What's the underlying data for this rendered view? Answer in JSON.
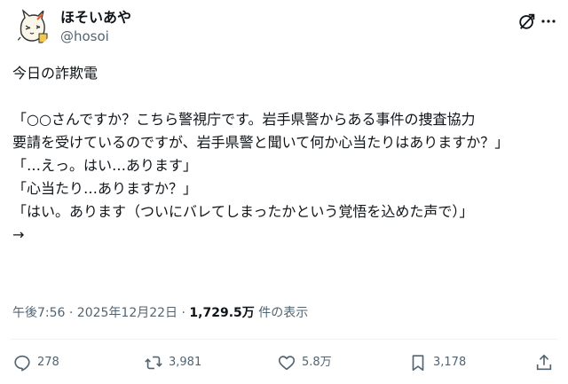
{
  "header": {
    "display_name": "ほそいあや",
    "handle": "@hosoi"
  },
  "tweet": {
    "lines": [
      "今日の詐欺電",
      "",
      "「○○さんですか？こちら警視庁です。岩手県警からある事件の捜査協力",
      "要請を受けているのですが、岩手県警と聞いて何か心当たりはありますか？」",
      "「…えっ。はい…あります」",
      "「心当たり…ありますか？」",
      "「はい。あります（ついにバレてしまったかという覚悟を込めた声で）」",
      "→"
    ]
  },
  "meta": {
    "timestamp": "午後7:56 · 2025年12月22日 · ",
    "views_count": "1,729.5万",
    "views_label": " 件の表示"
  },
  "actions": {
    "replies": "278",
    "reposts": "3,981",
    "likes": "5.8万",
    "bookmarks": "3,178"
  },
  "icons": [
    "grok-icon",
    "more-icon",
    "reply-icon",
    "repost-icon",
    "like-icon",
    "bookmark-icon",
    "share-icon"
  ]
}
